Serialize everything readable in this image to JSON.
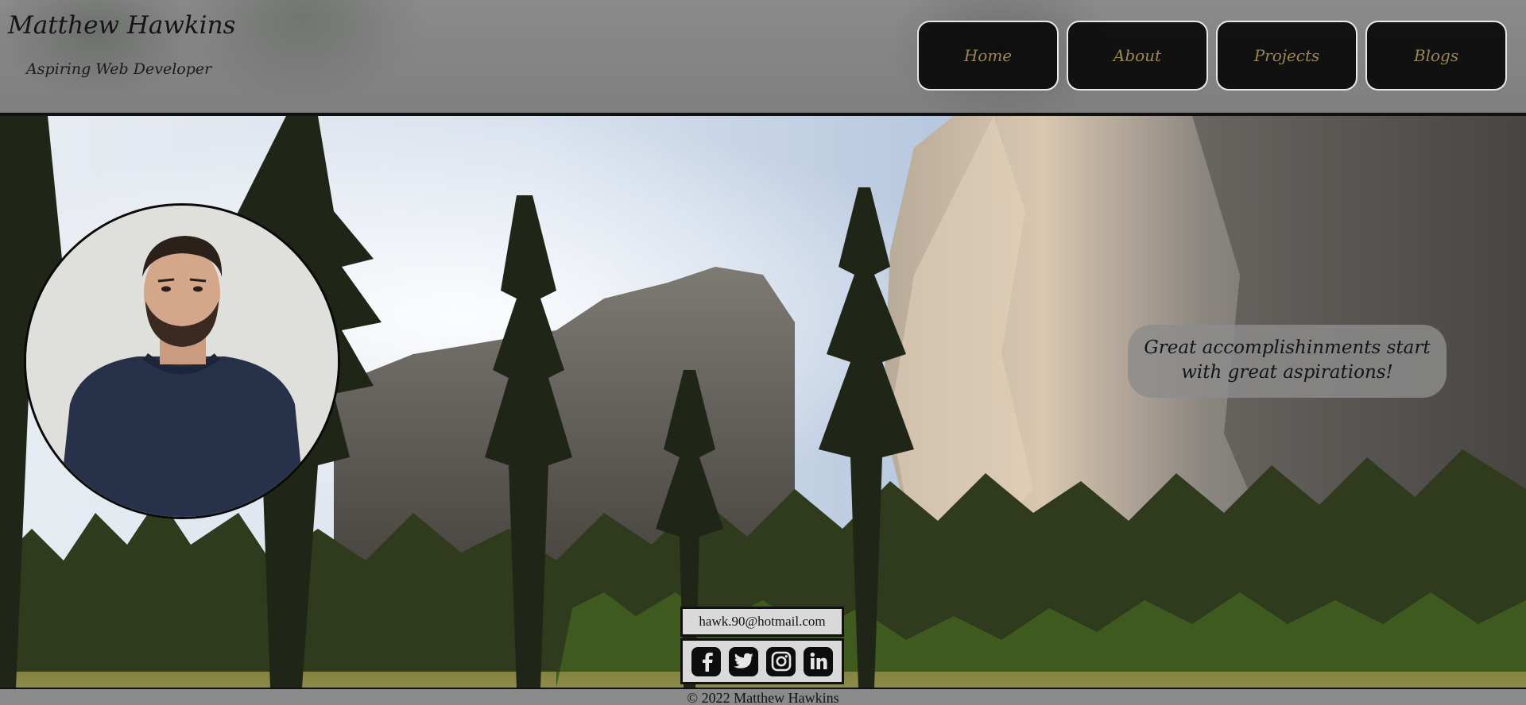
{
  "header": {
    "site_name": "Matthew Hawkins",
    "tagline": "Aspiring Web Developer"
  },
  "nav": {
    "items": [
      {
        "label": "Home"
      },
      {
        "label": "About"
      },
      {
        "label": "Projects"
      },
      {
        "label": "Blogs"
      }
    ]
  },
  "quote": {
    "line1": "Great accomplishinments start",
    "line2": "with great aspirations!"
  },
  "contact": {
    "email": "hawk.90@hotmail.com",
    "socials": [
      {
        "icon": "facebook-icon"
      },
      {
        "icon": "twitter-icon"
      },
      {
        "icon": "instagram-icon"
      },
      {
        "icon": "linkedin-icon"
      }
    ]
  },
  "footer": {
    "copyright": "© 2022 Matthew Hawkins"
  },
  "colors": {
    "nav_text": "#9a8553",
    "nav_background": "#080808",
    "header_background": "#858585"
  }
}
